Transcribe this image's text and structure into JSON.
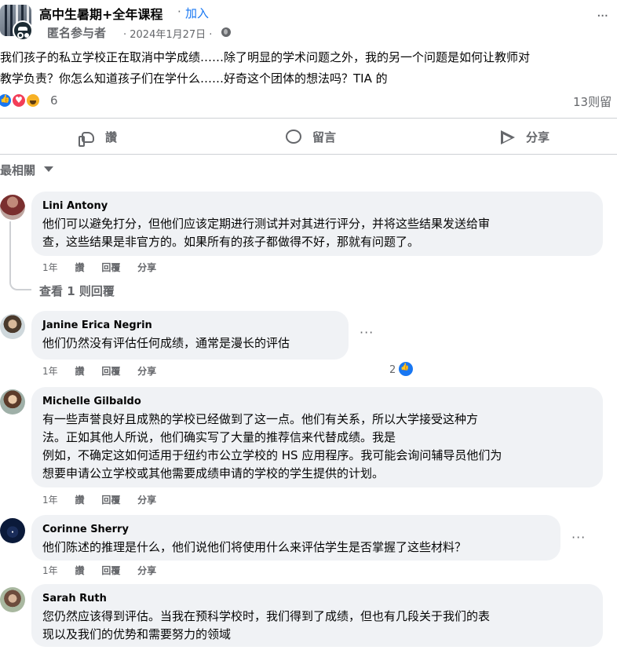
{
  "header": {
    "group_name": "高中生暑期+全年课程",
    "separator": "·",
    "join_label": "加入",
    "author": "匿名参与者",
    "date": "· 2024年1月27日 ·",
    "more_icon": "more-horizontal-icon"
  },
  "post": {
    "line1": "我们孩子的私立学校正在取消中学成绩……除了明显的学术问题之外，我的另一个问题是如何让教师对",
    "line2": "教学负责？你怎么知道孩子们在学什么……好奇这个团体的想法吗？TIA 的",
    "reaction_count": "6",
    "comment_count": "13则留"
  },
  "actions": {
    "like": "讚",
    "comment": "留言",
    "share": "分享"
  },
  "sort_label": "最相關",
  "comments": [
    {
      "name": "Lini Antony",
      "text": "他们可以避免打分，但他们应该定期进行测试并对其进行评分，并将这些结果发送给审\n查，这些结果是非官方的。如果所有的孩子都做得不好，那就有问题了。",
      "time": "1年",
      "like": "讚",
      "reply": "回覆",
      "share": "分享",
      "view_replies": "查看 1 则回覆"
    },
    {
      "name": "Janine Erica Negrin",
      "text": "他们仍然没有评估任何成绩，通常是漫长的评估",
      "time": "1年",
      "like": "讚",
      "reply": "回覆",
      "share": "分享",
      "reactions": "2"
    },
    {
      "name": "Michelle Gilbaldo",
      "text": "有一些声誉良好且成熟的学校已经做到了这一点。他们有关系，所以大学接受这种方\n法。正如其他人所说，他们确实写了大量的推荐信来代替成绩。我是\n例如，不确定这如何适用于纽约市公立学校的 HS 应用程序。我可能会询问辅导员他们为\n想要申请公立学校或其他需要成绩申请的学校的学生提供的计划。",
      "time": "1年",
      "like": "讚",
      "reply": "回覆",
      "share": "分享"
    },
    {
      "name": "Corinne Sherry",
      "text": "他们陈述的推理是什么，他们说他们将使用什么来评估学生是否掌握了这些材料？",
      "time": "1年",
      "like": "讚",
      "reply": "回覆",
      "share": "分享"
    },
    {
      "name": "Sarah Ruth",
      "text": "您仍然应该得到评估。当我在预科学校时，我们得到了成绩，但也有几段关于我们的表\n现以及我们的优势和需要努力的领域",
      "time": "",
      "like": "",
      "reply": "",
      "share": ""
    }
  ],
  "colors": {
    "accent": "#1877f2",
    "muted": "#65676b",
    "bubble": "#f0f2f5"
  }
}
